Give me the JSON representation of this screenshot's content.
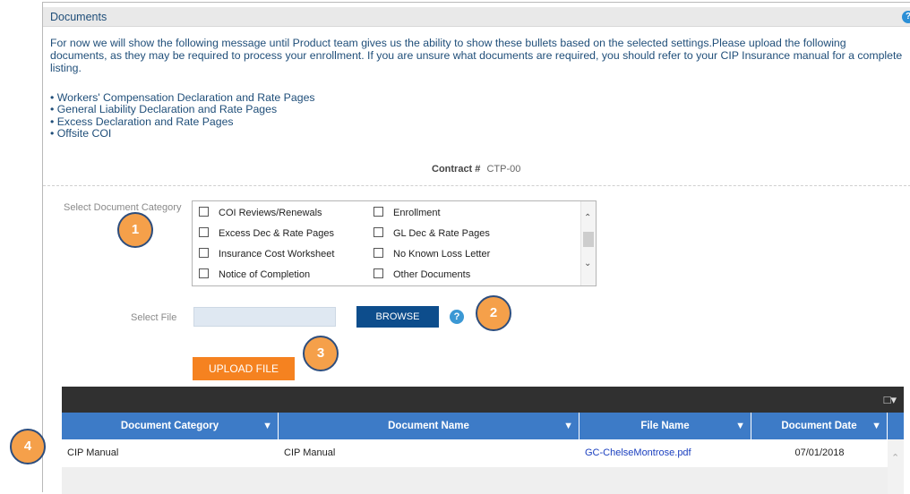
{
  "section": {
    "title": "Documents",
    "intro": "For now we will show the following message until Product team gives us the ability to show these bullets based on the selected settings.Please upload the following documents, as they may be required to process your enrollment. If you are unsure what documents are required, you should refer to your CIP Insurance manual for a complete listing.",
    "bullets": [
      "• Workers' Compensation Declaration and Rate Pages",
      "• General Liability Declaration and Rate Pages",
      "• Excess Declaration and Rate Pages",
      "• Offsite COI"
    ]
  },
  "contract": {
    "label": "Contract #",
    "value": "CTP-00"
  },
  "form": {
    "category_label": "Select Document Category",
    "categories": [
      "COI Reviews/Renewals",
      "Enrollment",
      "Excess Dec & Rate Pages",
      "GL Dec & Rate Pages",
      "Insurance Cost Worksheet",
      "No Known Loss Letter",
      "Notice of Completion",
      "Other Documents"
    ],
    "file_label": "Select File",
    "file_value": "",
    "browse_label": "BROWSE",
    "upload_label": "UPLOAD FILE"
  },
  "grid": {
    "columns": [
      "Document Category",
      "Document Name",
      "File Name",
      "Document Date"
    ],
    "rows": [
      {
        "category": "CIP Manual",
        "name": "CIP Manual",
        "file": "GC-ChelseMontrose.pdf",
        "date": "07/01/2018"
      }
    ]
  },
  "annotations": [
    "1",
    "2",
    "3",
    "4"
  ],
  "icons": {
    "help": "help-icon",
    "filter": "filter-icon",
    "export": "export-icon",
    "scroll_up": "chevron-up-icon",
    "scroll_down": "chevron-down-icon"
  },
  "colors": {
    "header_bg": "#e9e9e9",
    "title": "#1f4e79",
    "browse_bg": "#0d4d8c",
    "upload_bg": "#f58220",
    "grid_toolbar": "#303030",
    "grid_header": "#3d7bc7",
    "link": "#1a3fbf",
    "annotation_fill": "#f5a04a",
    "annotation_border": "#2d4d7d"
  }
}
